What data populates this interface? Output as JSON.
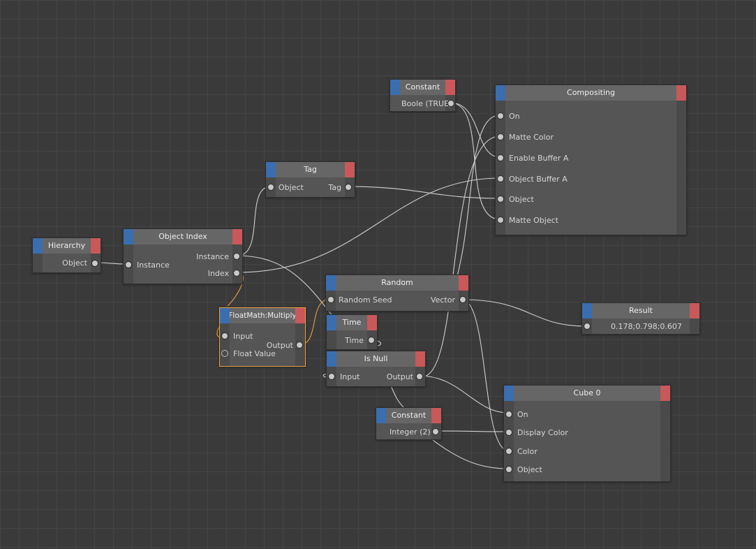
{
  "nodes": {
    "constant_bool": {
      "title": "Constant",
      "output": "Boole (TRUE)"
    },
    "compositing": {
      "title": "Compositing",
      "inputs": [
        "On",
        "Matte Color",
        "Enable Buffer A",
        "Object Buffer A",
        "Object",
        "Matte Object"
      ]
    },
    "tag": {
      "title": "Tag",
      "input": "Object",
      "output": "Tag"
    },
    "hierarchy": {
      "title": "Hierarchy",
      "output": "Object"
    },
    "object_index": {
      "title": "Object Index",
      "input": "Instance",
      "outputs": [
        "Instance",
        "Index"
      ]
    },
    "random": {
      "title": "Random",
      "input": "Random Seed",
      "output": "Vector"
    },
    "result": {
      "title": "Result",
      "value": "0.178;0.798;0.607"
    },
    "floatmath": {
      "title": "FloatMath:Multiply",
      "inputs": [
        "Input",
        "Float Value"
      ],
      "output": "Output"
    },
    "time": {
      "title": "Time",
      "output": "Time"
    },
    "is_null": {
      "title": "Is Null",
      "input": "Input",
      "output": "Output"
    },
    "constant_int": {
      "title": "Constant",
      "output": "Integer (2)"
    },
    "cube": {
      "title": "Cube 0",
      "inputs": [
        "On",
        "Display Color",
        "Color",
        "Object"
      ]
    }
  },
  "colors": {
    "header_blue": "#3b6eb0",
    "header_red": "#c9585a",
    "selected_border": "#e8a13a",
    "wire": "#cfcfcf",
    "wire_selected": "#e8a13a"
  }
}
